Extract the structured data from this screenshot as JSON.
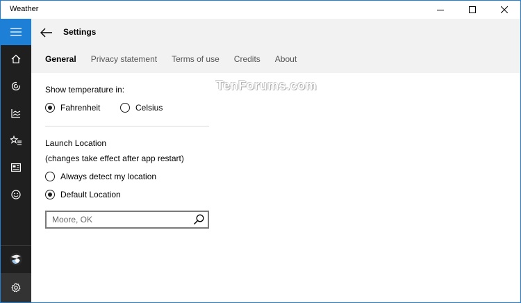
{
  "window": {
    "title": "Weather"
  },
  "page": {
    "title": "Settings"
  },
  "tabs": [
    {
      "label": "General",
      "active": true
    },
    {
      "label": "Privacy statement",
      "active": false
    },
    {
      "label": "Terms of use",
      "active": false
    },
    {
      "label": "Credits",
      "active": false
    },
    {
      "label": "About",
      "active": false
    }
  ],
  "sidebar": {
    "items": [
      {
        "icon": "home-icon"
      },
      {
        "icon": "forecast-icon"
      },
      {
        "icon": "historical-weather-icon"
      },
      {
        "icon": "places-icon"
      },
      {
        "icon": "news-icon"
      },
      {
        "icon": "feedback-icon"
      },
      {
        "icon": "account-icon"
      },
      {
        "icon": "settings-icon"
      }
    ]
  },
  "temperature": {
    "label": "Show temperature in:",
    "options": [
      {
        "label": "Fahrenheit",
        "selected": true
      },
      {
        "label": "Celsius",
        "selected": false
      }
    ]
  },
  "launch": {
    "label": "Launch Location",
    "note": "(changes take effect after app restart)",
    "options": [
      {
        "label": "Always detect my location",
        "selected": false
      },
      {
        "label": "Default Location",
        "selected": true
      }
    ],
    "location_value": "Moore, OK"
  },
  "watermark": "TenForums.com",
  "colors": {
    "accent": "#1e7fd6",
    "sidebar": "#1f1f1f",
    "header": "#f2f2f2"
  }
}
